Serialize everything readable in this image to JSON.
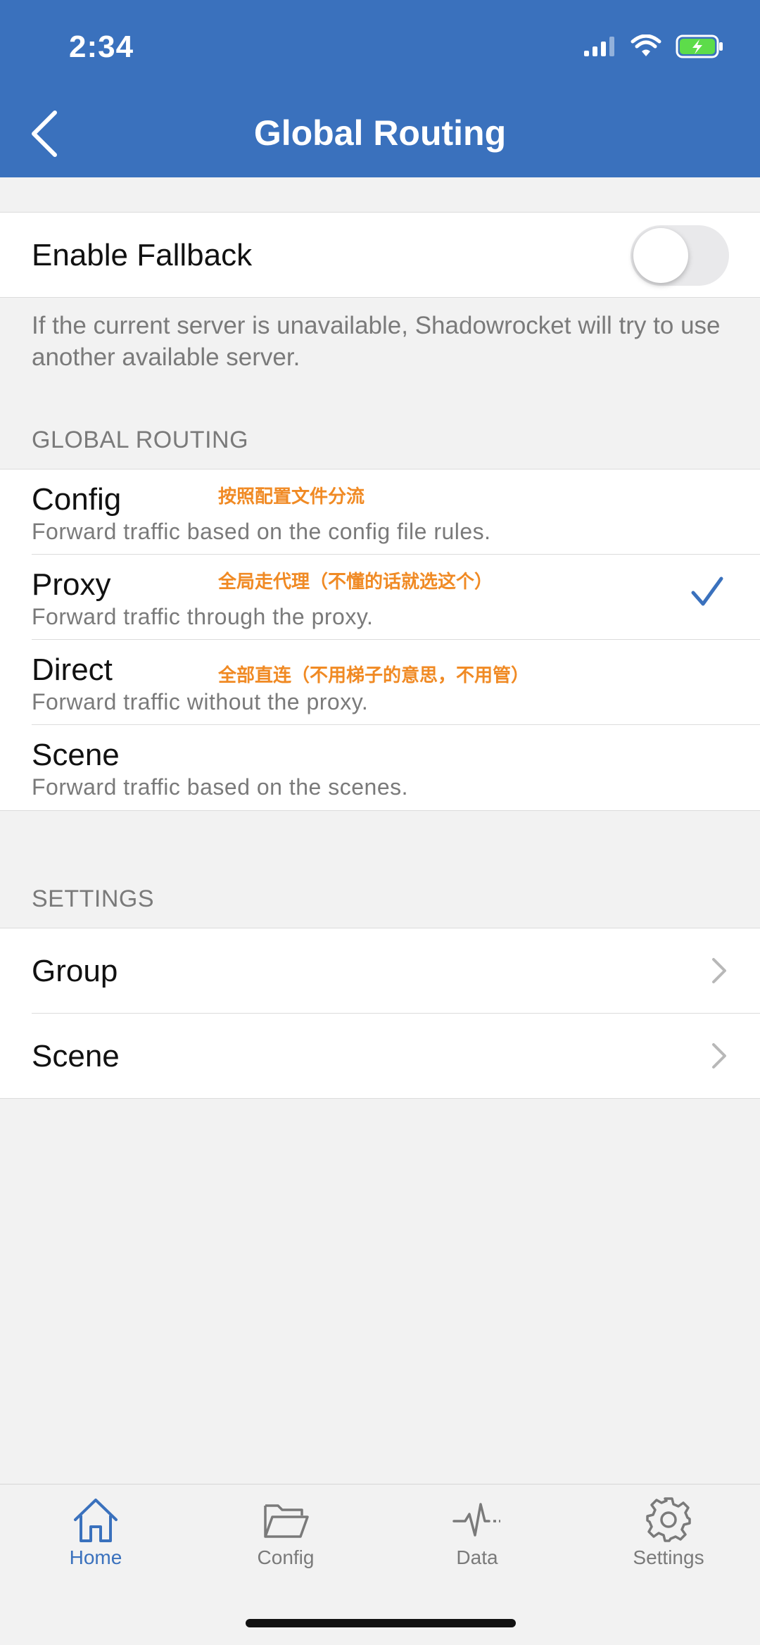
{
  "status_bar": {
    "time": "2:34"
  },
  "nav": {
    "title": "Global Routing"
  },
  "fallback": {
    "label": "Enable Fallback",
    "enabled": false,
    "note": "If the current server is unavailable, Shadowrocket will try to use another available server."
  },
  "global_routing": {
    "header": "GLOBAL ROUTING",
    "options": [
      {
        "title": "Config",
        "subtitle": "Forward traffic based on the config file rules.",
        "note": "按照配置文件分流",
        "selected": false
      },
      {
        "title": "Proxy",
        "subtitle": "Forward traffic through the proxy.",
        "note": "全局走代理（不懂的话就选这个）",
        "selected": true
      },
      {
        "title": "Direct",
        "subtitle": "Forward traffic without the proxy.",
        "note": "全部直连（不用梯子的意思，不用管）",
        "selected": false
      },
      {
        "title": "Scene",
        "subtitle": "Forward traffic based on the scenes.",
        "note": "",
        "selected": false
      }
    ]
  },
  "settings": {
    "header": "SETTINGS",
    "items": [
      {
        "label": "Group"
      },
      {
        "label": "Scene"
      }
    ]
  },
  "tabbar": {
    "items": [
      {
        "label": "Home",
        "icon": "home-icon",
        "active": true
      },
      {
        "label": "Config",
        "icon": "folder-icon",
        "active": false
      },
      {
        "label": "Data",
        "icon": "pulse-icon",
        "active": false
      },
      {
        "label": "Settings",
        "icon": "gear-icon",
        "active": false
      }
    ],
    "active_color": "#3a71bd",
    "inactive_color": "#7a7a7a"
  },
  "colors": {
    "header": "#3a71bd",
    "annotation": "#f08a24",
    "checkmark": "#3a71bd"
  }
}
